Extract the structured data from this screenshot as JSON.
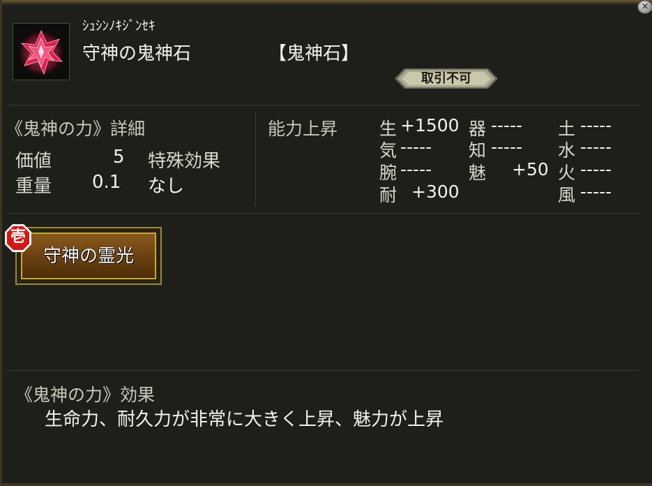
{
  "close_label": "×",
  "item": {
    "reading": "ｼｭｼﾝﾉｷｼﾞﾝｾｷ",
    "name": "守神の鬼神石",
    "category": "【鬼神石】",
    "trade_status": "取引不可",
    "icon": "red-crystal-gem-icon"
  },
  "detail": {
    "title": "《鬼神の力》詳細",
    "value_label": "価値",
    "value": "5",
    "weight_label": "重量",
    "weight": "0.1",
    "special_label": "特殊効果",
    "special_value": "なし"
  },
  "ability": {
    "title": "能力上昇",
    "stats": {
      "sei": {
        "label": "生",
        "value": "+1500"
      },
      "ki_spirit": {
        "label": "気",
        "value": "-----"
      },
      "ude": {
        "label": "腕",
        "value": "-----"
      },
      "tai": {
        "label": "耐",
        "value": "+300"
      },
      "ki_tool": {
        "label": "器",
        "value": "-----"
      },
      "chi": {
        "label": "知",
        "value": "-----"
      },
      "mi": {
        "label": "魅",
        "value": "+50"
      },
      "do": {
        "label": "土",
        "value": "-----"
      },
      "mizu": {
        "label": "水",
        "value": "-----"
      },
      "hi": {
        "label": "火",
        "value": "-----"
      },
      "kaze": {
        "label": "風",
        "value": "-----"
      }
    }
  },
  "skill": {
    "badge": "壱",
    "label": "守神の霊光"
  },
  "effect": {
    "title": "《鬼神の力》効果",
    "text": "生命力、耐久力が非常に大きく上昇、魅力が上昇"
  },
  "colors": {
    "background": "#1e1f1a",
    "text": "#f2f2ee",
    "muted_text": "#c9c9b9",
    "gem": "#e0285a",
    "skill_button": "#7a4a15",
    "badge": "#d01818"
  }
}
